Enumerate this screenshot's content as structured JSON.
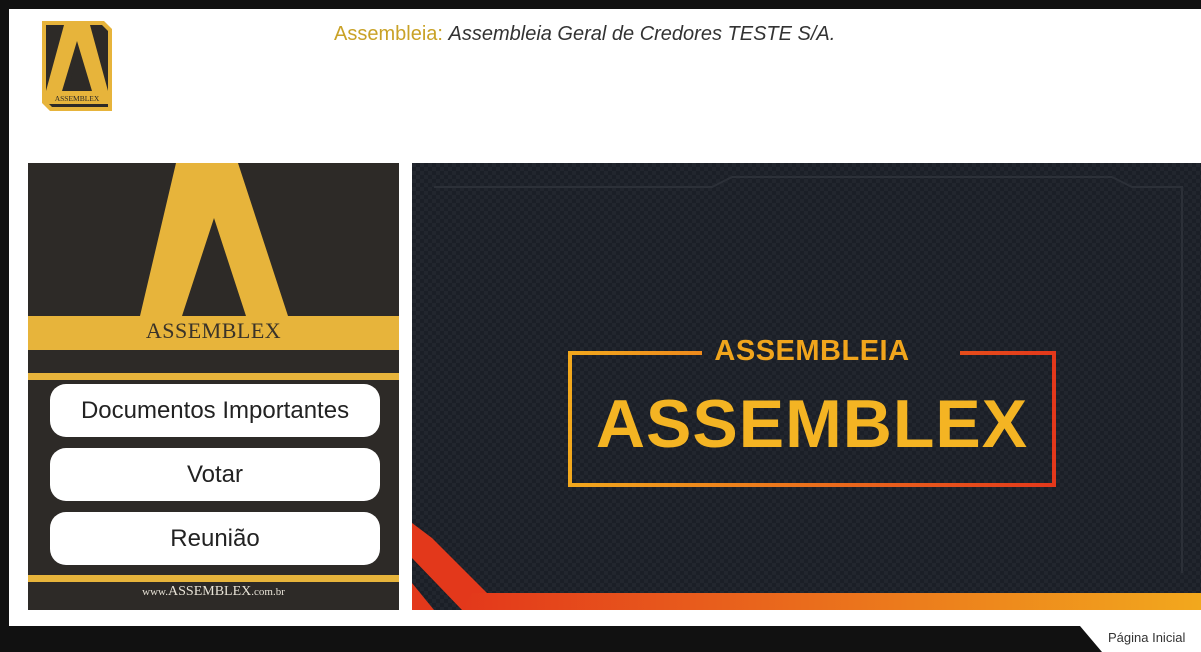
{
  "header": {
    "label": "Assembleia:",
    "assembly_name": "Assembleia Geral de Credores TESTE S/A."
  },
  "logo": {
    "text": "ASSEMBLEX",
    "colors": {
      "gold": "#e7b43b",
      "dark": "#2d2a27"
    }
  },
  "sidebar": {
    "brand": "ASSEMBLEX",
    "buttons": [
      {
        "label": "Documentos Importantes"
      },
      {
        "label": "Votar"
      },
      {
        "label": "Reunião"
      }
    ],
    "url_prefix": "www.",
    "url_brand": "ASSEMBLEX",
    "url_suffix": ".com.br"
  },
  "banner": {
    "subtitle": "ASSEMBLEIA",
    "title": "ASSEMBLEX",
    "colors": {
      "frame": "#e8451c",
      "text": "#f4b423",
      "background": "#1b1f27"
    }
  },
  "footer": {
    "link": "Página Inicial"
  }
}
